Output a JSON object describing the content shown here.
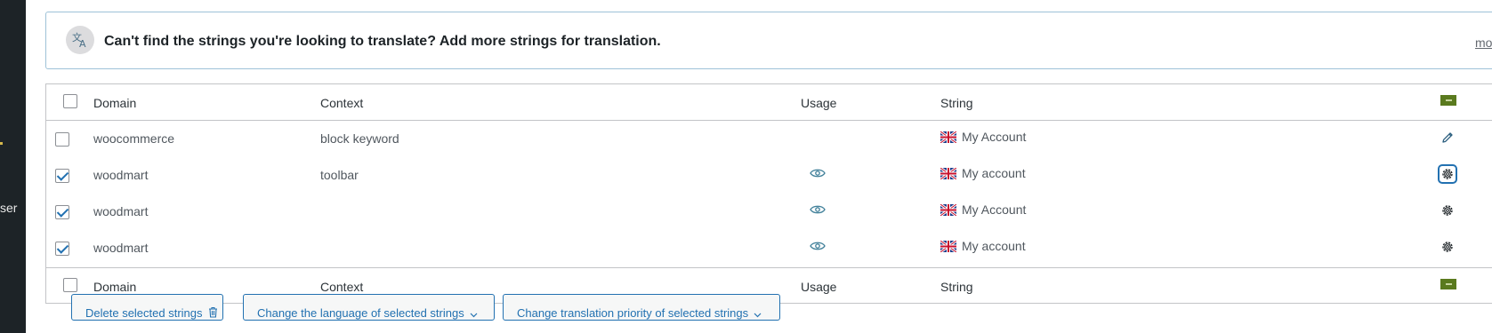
{
  "sidebar": {
    "partial_label": "ser"
  },
  "notice": {
    "message": "Can't find the strings you're looking to translate? Add more strings for translation.",
    "more_link": "more o"
  },
  "table": {
    "columns": {
      "domain": "Domain",
      "context": "Context",
      "usage": "Usage",
      "string": "String"
    },
    "rows": [
      {
        "checked": false,
        "domain": "woocommerce",
        "context": "block keyword",
        "usage_icon": "eye-icon",
        "usage_visible": false,
        "flag": "uk-flag-icon",
        "string": "My Account",
        "action": "pencil-icon"
      },
      {
        "checked": true,
        "domain": "woodmart",
        "context": "toolbar",
        "usage_icon": "eye-icon",
        "usage_visible": true,
        "flag": "uk-flag-icon",
        "string": "My account",
        "action": "gear-icon"
      },
      {
        "checked": true,
        "domain": "woodmart",
        "context": "",
        "usage_icon": "eye-icon",
        "usage_visible": true,
        "flag": "uk-flag-icon",
        "string": "My Account",
        "action": "gear-icon"
      },
      {
        "checked": true,
        "domain": "woodmart",
        "context": "",
        "usage_icon": "eye-icon",
        "usage_visible": true,
        "flag": "uk-flag-icon",
        "string": "My account",
        "action": "gear-icon"
      }
    ]
  },
  "actions": {
    "delete": "Delete selected strings",
    "change_language": "Change the language of selected strings",
    "change_priority": "Change translation priority of selected strings"
  },
  "colors": {
    "accent": "#2271b1",
    "notice_border": "#9ec2d8",
    "eye": "#3f7f99",
    "lang_flag": "#5a7a1e"
  }
}
